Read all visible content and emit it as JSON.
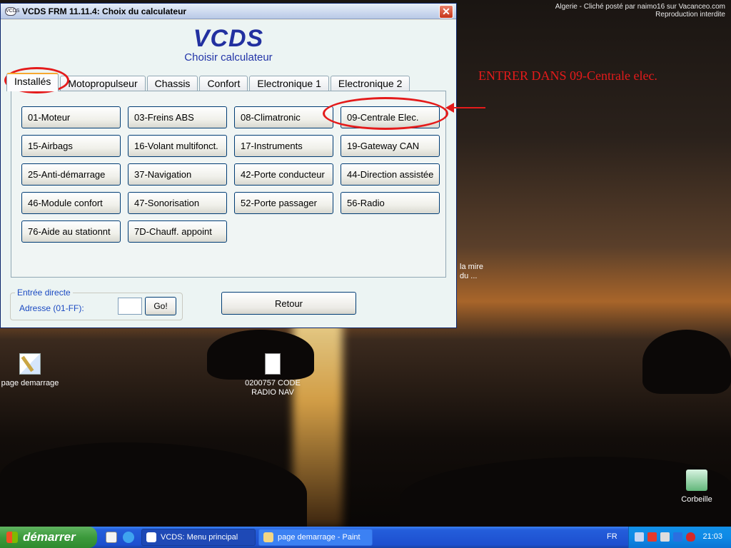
{
  "watermark": {
    "line1": "Algerie - Cliché posté par naimo16 sur Vacanceo.com",
    "line2": "Reproduction interdite"
  },
  "window": {
    "title": "VCDS FRM 11.11.4:   Choix du calculateur",
    "close_glyph": "✕",
    "icon_text": "VCDS",
    "brand_title": "VCDS",
    "brand_subtitle": "Choisir calculateur"
  },
  "tabs": [
    {
      "label": "Installés",
      "active": true
    },
    {
      "label": "Motopropulseur",
      "active": false
    },
    {
      "label": "Chassis",
      "active": false
    },
    {
      "label": "Confort",
      "active": false
    },
    {
      "label": "Electronique 1",
      "active": false
    },
    {
      "label": "Electronique 2",
      "active": false
    }
  ],
  "modules": [
    "01-Moteur",
    "03-Freins ABS",
    "08-Climatronic",
    "09-Centrale Elec.",
    "15-Airbags",
    "16-Volant multifonct.",
    "17-Instruments",
    "19-Gateway CAN",
    "25-Anti-démarrage",
    "37-Navigation",
    "42-Porte conducteur",
    "44-Direction assistée",
    "46-Module confort",
    "47-Sonorisation",
    "52-Porte passager",
    "56-Radio",
    "76-Aide au stationnt",
    "7D-Chauff. appoint"
  ],
  "direct_entry": {
    "legend": "Entrée directe",
    "address_label": "Adresse (01-FF):",
    "address_value": "",
    "go_label": "Go!"
  },
  "retour_label": "Retour",
  "annotation": {
    "text": "ENTRER DANS 09-Centrale elec.",
    "color": "#e41b1b"
  },
  "desktop_icons": {
    "page_demarrage": "page demarrage",
    "code_radio_line1": "0200757 CODE",
    "code_radio_line2": "RADIO NAV",
    "la_mire_line1": "la mire",
    "la_mire_line2": "du ...",
    "corbeille": "Corbeille"
  },
  "taskbar": {
    "start_label": "démarrer",
    "tasks": [
      {
        "label": "VCDS:  Menu principal",
        "active": true
      },
      {
        "label": "page demarrage - Paint",
        "active": false
      }
    ],
    "language": "FR",
    "clock": "21:03"
  }
}
